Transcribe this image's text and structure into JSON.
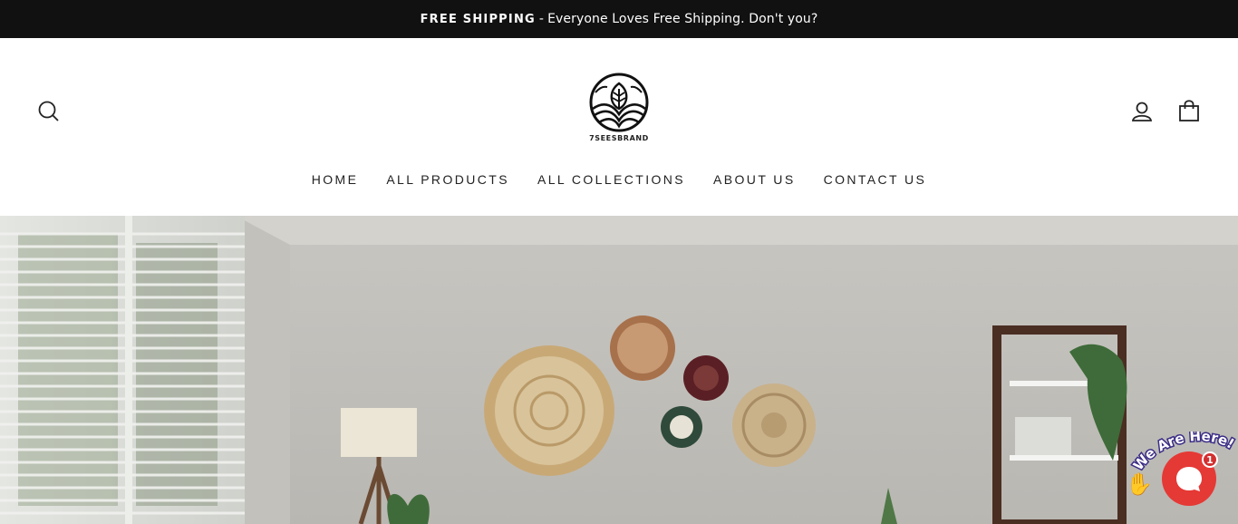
{
  "announcement": {
    "strong": "FREE SHIPPING",
    "separator": "-",
    "text": "Everyone Loves Free Shipping. Don't you?"
  },
  "header": {
    "logo_text": "7SEESBRAND",
    "search_icon": "search-icon",
    "account_icon": "user-icon",
    "cart_icon": "shopping-bag-icon"
  },
  "nav": {
    "items": [
      {
        "label": "HOME"
      },
      {
        "label": "ALL PRODUCTS"
      },
      {
        "label": "ALL COLLECTIONS"
      },
      {
        "label": "ABOUT US"
      },
      {
        "label": "CONTACT US"
      }
    ]
  },
  "chat": {
    "label": "We Are Here!",
    "badge": "1",
    "accent": "#e53935"
  },
  "colors": {
    "announce_bg": "#111111",
    "text": "#222222"
  }
}
